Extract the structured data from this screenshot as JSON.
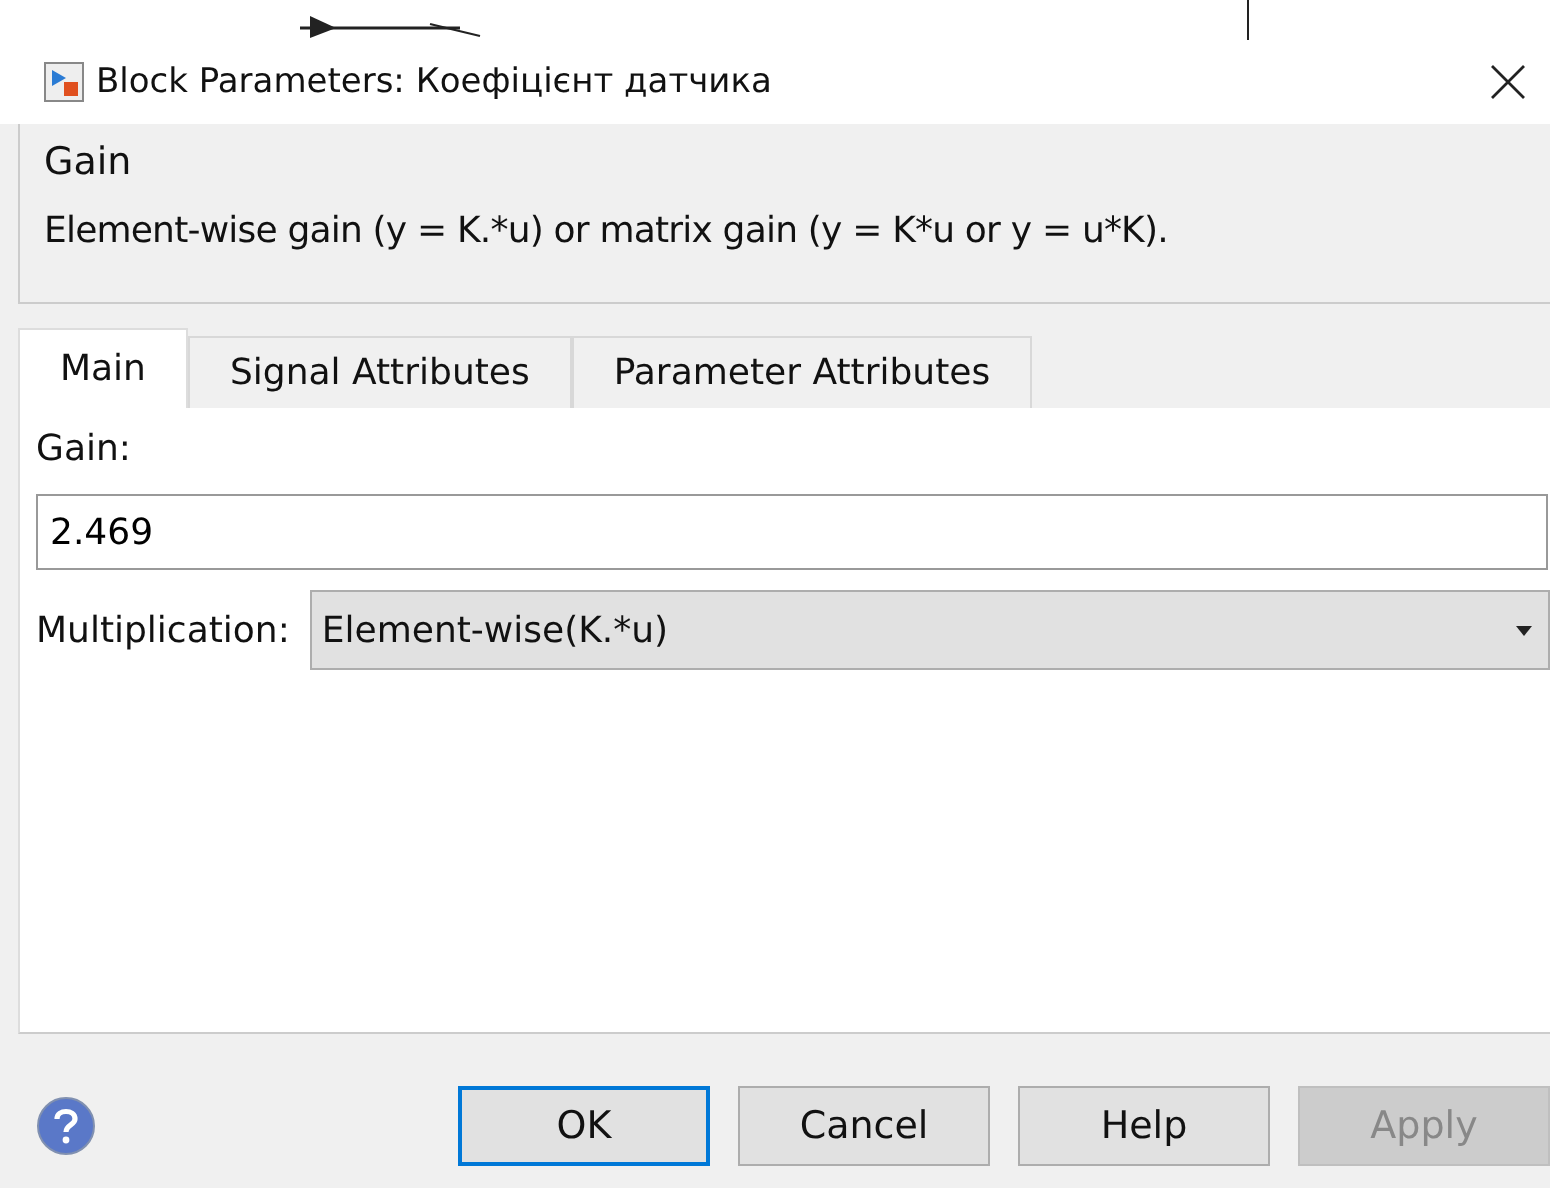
{
  "window": {
    "title": "Block Parameters: Коефіцієнт датчика"
  },
  "group": {
    "title": "Gain",
    "description": "Element-wise gain (y = K.*u) or matrix gain (y = K*u or y = u*K)."
  },
  "tabs": [
    {
      "label": "Main",
      "selected": true
    },
    {
      "label": "Signal Attributes",
      "selected": false
    },
    {
      "label": "Parameter Attributes",
      "selected": false
    }
  ],
  "gain": {
    "label": "Gain:",
    "value": "2.469"
  },
  "multiplication": {
    "label": "Multiplication:",
    "value": "Element-wise(K.*u)"
  },
  "buttons": [
    {
      "label": "OK",
      "default": true,
      "disabled": false
    },
    {
      "label": "Cancel",
      "default": false,
      "disabled": false
    },
    {
      "label": "Help",
      "default": false,
      "disabled": false
    },
    {
      "label": "Apply",
      "default": false,
      "disabled": true
    }
  ]
}
